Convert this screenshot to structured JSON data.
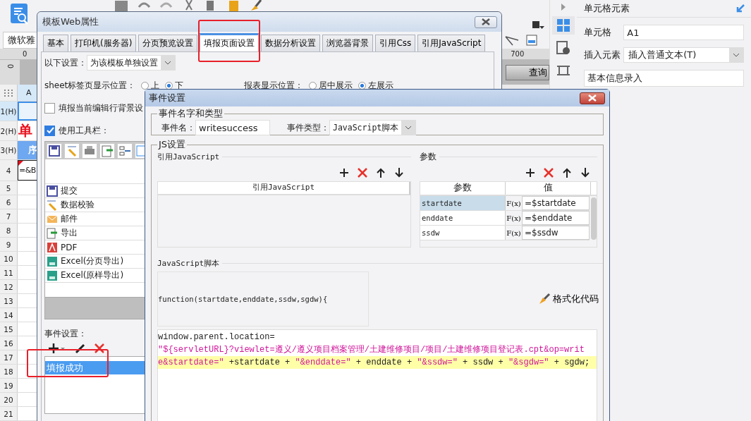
{
  "toolbar": {
    "font_field": "微软雅"
  },
  "ruler": {
    "top_start": "0",
    "top_end": "700",
    "side": "0"
  },
  "query_button": "查询",
  "sheet": {
    "column": "A",
    "rows": [
      {
        "label": "1(H)",
        "kind": "plain",
        "selected": true
      },
      {
        "label": "2(H)",
        "kind": "title",
        "cell": "单",
        "selected": false
      },
      {
        "label": "3(H)",
        "kind": "header",
        "cell": "序",
        "selected": false
      },
      {
        "label": "4",
        "kind": "formula",
        "cell": "=&B",
        "selected": false
      },
      {
        "label": "5",
        "kind": "plain",
        "selected": false
      },
      {
        "label": "6",
        "kind": "plain",
        "selected": false
      },
      {
        "label": "7",
        "kind": "plain",
        "selected": false
      },
      {
        "label": "8",
        "kind": "plain",
        "selected": false
      },
      {
        "label": "9",
        "kind": "plain",
        "selected": false
      },
      {
        "label": "10",
        "kind": "plain",
        "selected": false
      },
      {
        "label": "11",
        "kind": "plain",
        "selected": false
      },
      {
        "label": "12",
        "kind": "plain",
        "selected": false
      },
      {
        "label": "13",
        "kind": "plain",
        "selected": false
      },
      {
        "label": "14",
        "kind": "plain",
        "selected": false
      },
      {
        "label": "15",
        "kind": "plain",
        "selected": false
      },
      {
        "label": "16",
        "kind": "plain",
        "selected": false
      },
      {
        "label": "17",
        "kind": "plain",
        "selected": false
      },
      {
        "label": "18",
        "kind": "plain",
        "selected": false
      },
      {
        "label": "19",
        "kind": "plain",
        "selected": false
      },
      {
        "label": "20",
        "kind": "plain",
        "selected": false
      },
      {
        "label": "21",
        "kind": "plain",
        "selected": false
      }
    ]
  },
  "right_panel": {
    "title": "单元格元素",
    "side_tabs": [
      {
        "kind": "cell",
        "selected": true
      },
      {
        "kind": "info",
        "selected": false
      },
      {
        "kind": "frame",
        "selected": false
      }
    ],
    "cell_label": "单元格",
    "cell_value": "A1",
    "insert_label": "插入元素",
    "insert_value": "插入普通文本(T)",
    "content_value": "基本信息录入"
  },
  "web_dialog": {
    "title": "模板Web属性",
    "tabs": [
      {
        "label": "基本",
        "selected": false
      },
      {
        "label": "打印机(服务器)",
        "selected": false
      },
      {
        "label": "分页预览设置",
        "selected": false
      },
      {
        "label": "填报页面设置",
        "selected": true
      },
      {
        "label": "数据分析设置",
        "selected": false
      },
      {
        "label": "浏览器背景",
        "selected": false
      },
      {
        "label": "引用Css",
        "selected": false
      },
      {
        "label": "引用JavaScript",
        "selected": false
      }
    ],
    "scope": {
      "label": "以下设置：",
      "value": "为该模板单独设置"
    },
    "sheet_position": {
      "label": "sheet标签页显示位置：",
      "options": [
        {
          "label": "上",
          "selected": false
        },
        {
          "label": "下",
          "selected": true
        }
      ]
    },
    "report_position": {
      "label": "报表显示位置：",
      "options": [
        {
          "label": "居中展示",
          "selected": false
        },
        {
          "label": "左展示",
          "selected": true
        }
      ]
    },
    "highlight_row": {
      "label": "填报当前编辑行背景设",
      "checked": false
    },
    "use_toolbar": {
      "label": "使用工具栏：",
      "checked": true
    },
    "toolbar_buttons": [
      {
        "label": "提交",
        "kind": "save"
      },
      {
        "label": "数据校验",
        "kind": "pencil"
      },
      {
        "label": "邮件",
        "kind": "mail"
      },
      {
        "label": "导出",
        "kind": "export"
      },
      {
        "label": "PDF",
        "kind": "pdf"
      },
      {
        "label": "Excel(分页导出)",
        "kind": "excel"
      },
      {
        "label": "Excel(原样导出)",
        "kind": "excel"
      }
    ],
    "events": {
      "label": "事件设置：",
      "items": [
        {
          "label": "填报成功",
          "selected": true
        }
      ]
    }
  },
  "event_dialog": {
    "title": "事件设置",
    "name_group": {
      "legend": "事件名字和类型",
      "name_label": "事件名：",
      "name_value": "writesuccess",
      "type_label": "事件类型：",
      "type_value": "JavaScript脚本"
    },
    "js_group": {
      "legend": "JS设置",
      "refs": {
        "title": "引用JavaScript",
        "column": "引用JavaScript"
      },
      "params": {
        "title": "参数",
        "columns": [
          "参数",
          "值"
        ],
        "rows": [
          {
            "name": "startdate",
            "fx": "F(x)",
            "value": "=$startdate",
            "selected": true
          },
          {
            "name": "enddate",
            "fx": "F(x)",
            "value": "=$enddate",
            "selected": false
          },
          {
            "name": "ssdw",
            "fx": "F(x)",
            "value": "=$ssdw",
            "selected": false
          }
        ]
      },
      "script": {
        "title": "JavaScript脚本",
        "signature": "function(startdate,enddate,ssdw,sgdw){",
        "format_button": "格式化代码",
        "lines": [
          {
            "highlighted": false,
            "segments": [
              {
                "kind": "plain",
                "text": "window.parent.location="
              }
            ]
          },
          {
            "highlighted": false,
            "segments": [
              {
                "kind": "string",
                "text": "\"${servletURL}?viewlet=遵义/遵义项目档案管理/土建维修项目/项目/土建维修项目登记表.cpt&op=writ"
              }
            ]
          },
          {
            "highlighted": true,
            "segments": [
              {
                "kind": "string",
                "text": "e&startdate=\""
              },
              {
                "kind": "plain",
                "text": " +startdate + "
              },
              {
                "kind": "string",
                "text": "\"&enddate=\""
              },
              {
                "kind": "plain",
                "text": " + enddate + "
              },
              {
                "kind": "string",
                "text": "\"&ssdw=\""
              },
              {
                "kind": "plain",
                "text": " + ssdw + "
              },
              {
                "kind": "string",
                "text": "\"&sgdw=\""
              },
              {
                "kind": "plain",
                "text": " + sgdw;"
              }
            ]
          }
        ]
      }
    }
  }
}
